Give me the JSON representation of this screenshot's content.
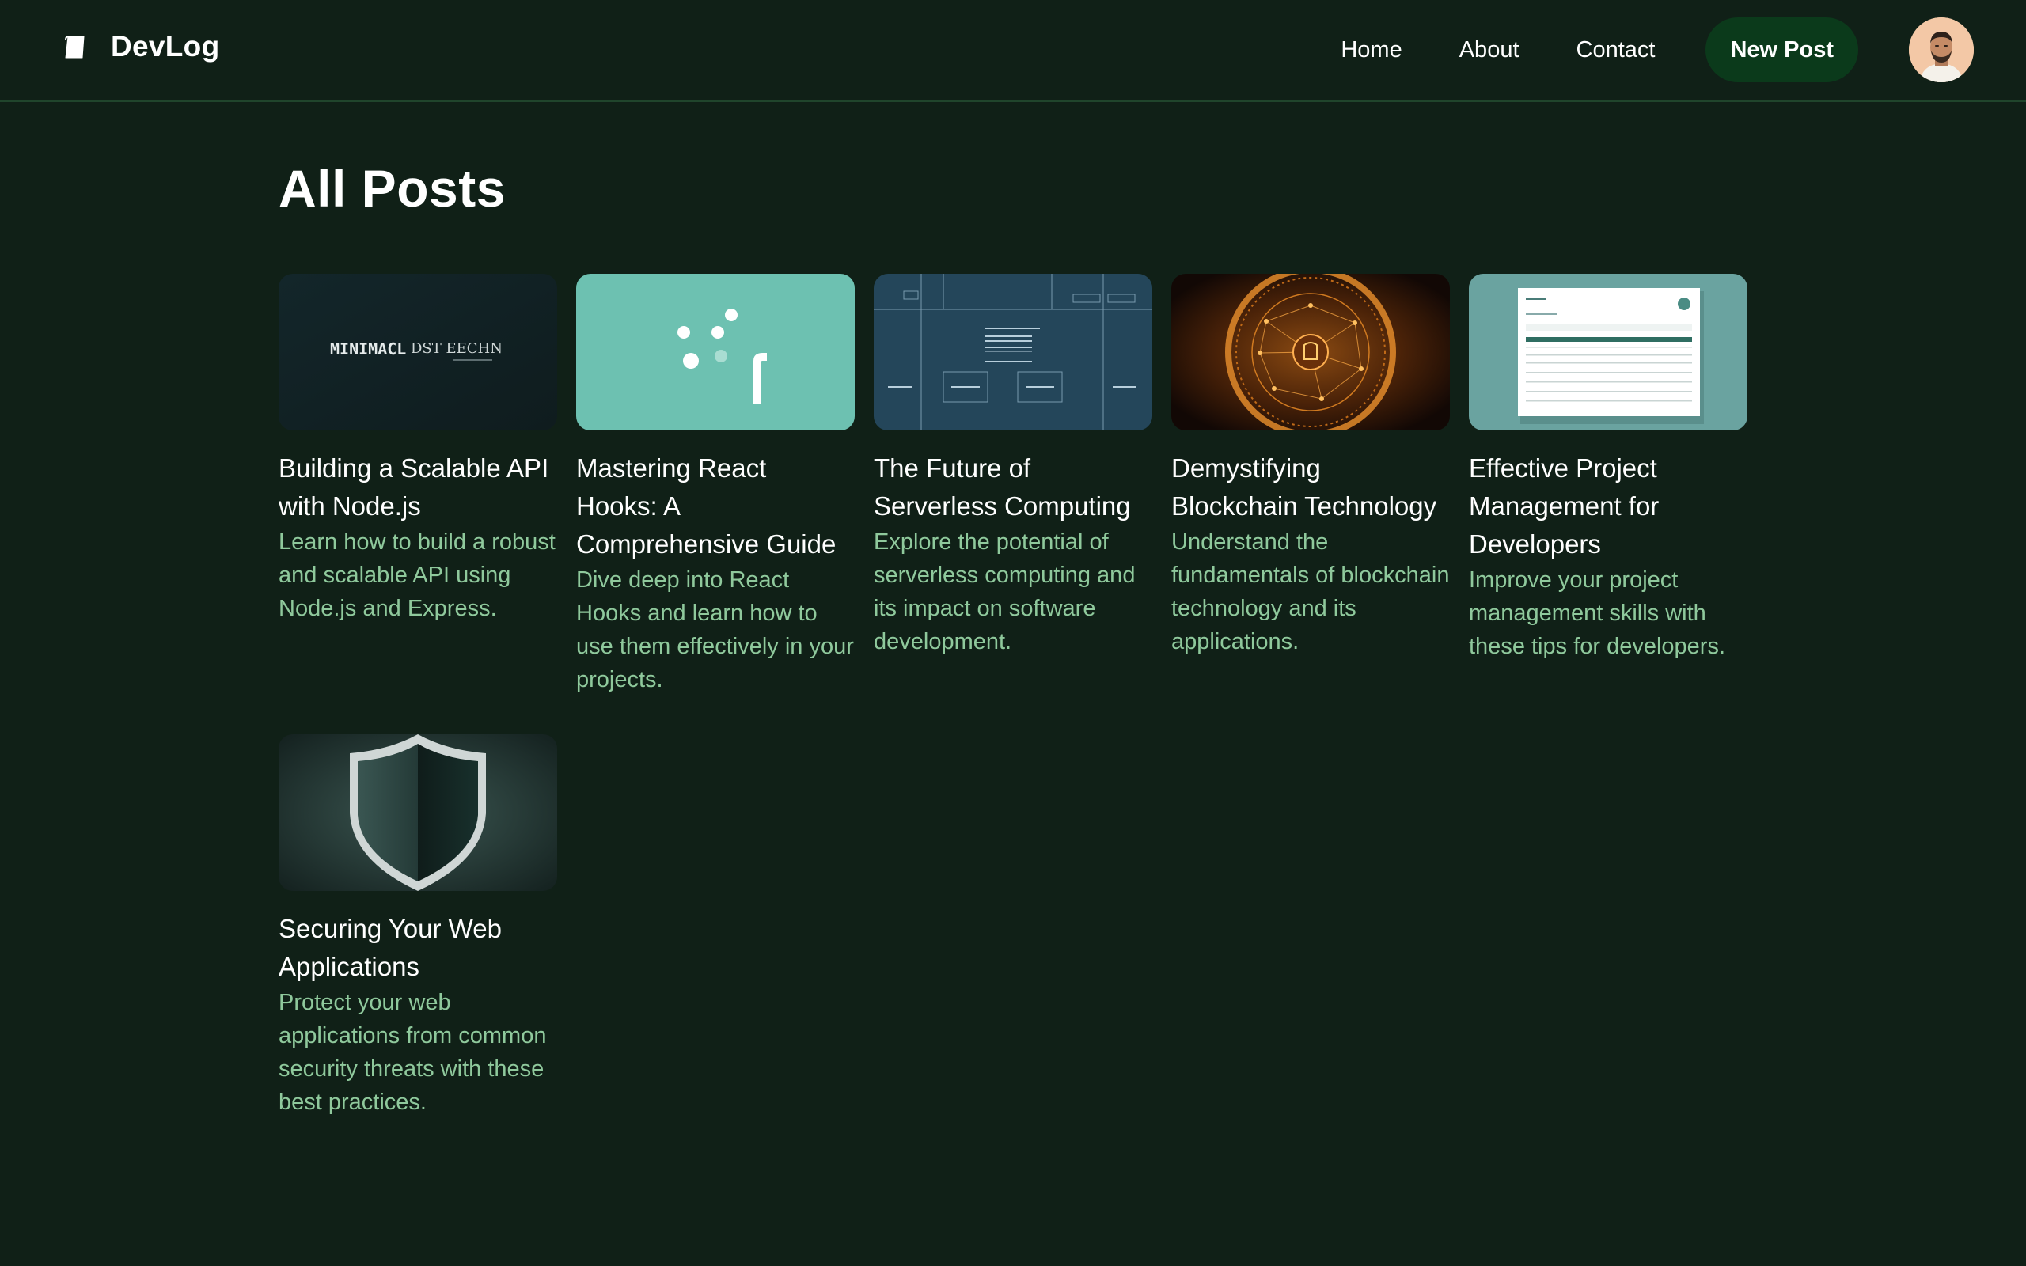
{
  "brand": {
    "name": "DevLog"
  },
  "nav": {
    "links": [
      "Home",
      "About",
      "Contact"
    ],
    "new_post_label": "New Post"
  },
  "main": {
    "title": "All Posts",
    "posts": [
      {
        "title": "Building a Scalable API with Node.js",
        "description": "Learn how to build a robust and scalable API using Node.js and Express.",
        "thumb_text_left": "MINIMACL",
        "thumb_text_right": "DST EECHN"
      },
      {
        "title": "Mastering React Hooks: A Comprehensive Guide",
        "description": "Dive deep into React Hooks and learn how to use them effectively in your projects."
      },
      {
        "title": "The Future of Serverless Computing",
        "description": "Explore the potential of serverless computing and its impact on software development."
      },
      {
        "title": "Demystifying Blockchain Technology",
        "description": "Understand the fundamentals of blockchain technology and its applications."
      },
      {
        "title": "Effective Project Management for Developers",
        "description": "Improve your project management skills with these tips for developers."
      },
      {
        "title": "Securing Your Web Applications",
        "description": "Protect your web applications from common security threats with these best practices."
      }
    ]
  },
  "colors": {
    "background": "#102017",
    "accent_button": "#0b3a1b",
    "description_text": "#8fc99c",
    "divider": "#20452c"
  },
  "icons": {
    "brand": "book-icon",
    "avatar": "user-avatar"
  }
}
